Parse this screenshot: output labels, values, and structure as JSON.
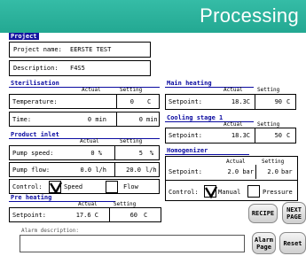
{
  "header": {
    "title": "Processing"
  },
  "project": {
    "title": "Project",
    "name_label": "Project name:",
    "name_value": "EERSTE TEST",
    "desc_label": "Description:",
    "desc_value": "F4S5"
  },
  "sterilisation": {
    "title": "Sterilisation",
    "actual_hdr": "Actual",
    "setting_hdr": "Setting",
    "temp_label": "Temperature:",
    "temp_setting": "0",
    "temp_unit": "C",
    "time_label": "Time:",
    "time_actual": "0 min",
    "time_setting": "0",
    "time_unit": "min"
  },
  "product_inlet": {
    "title": "Product inlet",
    "actual_hdr": "Actual",
    "setting_hdr": "Setting",
    "speed_label": "Pump speed:",
    "speed_actual": "0 %",
    "speed_setting": "5",
    "speed_unit": "%",
    "flow_label": "Pump flow:",
    "flow_actual": "0.0 l/h",
    "flow_setting": "20.0",
    "flow_unit": "l/h",
    "control_label": "Control:",
    "opt_speed": "Speed",
    "opt_flow": "Flow"
  },
  "pre_heating": {
    "title": "Pre heating",
    "actual_hdr": "Actual",
    "setting_hdr": "Setting",
    "setpoint_label": "Setpoint:",
    "actual": "17.6 C",
    "setting": "60",
    "unit": "C"
  },
  "main_heating": {
    "title": "Main heating",
    "actual_hdr": "Actual",
    "setting_hdr": "Setting",
    "setpoint_label": "Setpoint:",
    "actual": "18.3C",
    "setting": "90",
    "unit": "C"
  },
  "cooling": {
    "title": "Cooling stage 1",
    "actual_hdr": "Actual",
    "setting_hdr": "Setting",
    "setpoint_label": "Setpoint:",
    "actual": "18.3C",
    "setting": "50",
    "unit": "C"
  },
  "homogenizer": {
    "title": "Homogenizer",
    "actual_hdr": "Actual",
    "setting_hdr": "Setting",
    "setpoint_label": "Setpoint:",
    "actual": "2.0 bar",
    "setting": "2.0",
    "unit": "bar",
    "control_label": "Control:",
    "opt_manual": "Manual",
    "opt_pressure": "Pressure"
  },
  "buttons": {
    "recipe": "RECIPE",
    "next_l1": "NEXT",
    "next_l2": "PAGE",
    "alarm_l1": "Alarm",
    "alarm_l2": "Page",
    "reset": "Reset"
  },
  "alarm": {
    "label": "Alarm description:",
    "value": ""
  }
}
